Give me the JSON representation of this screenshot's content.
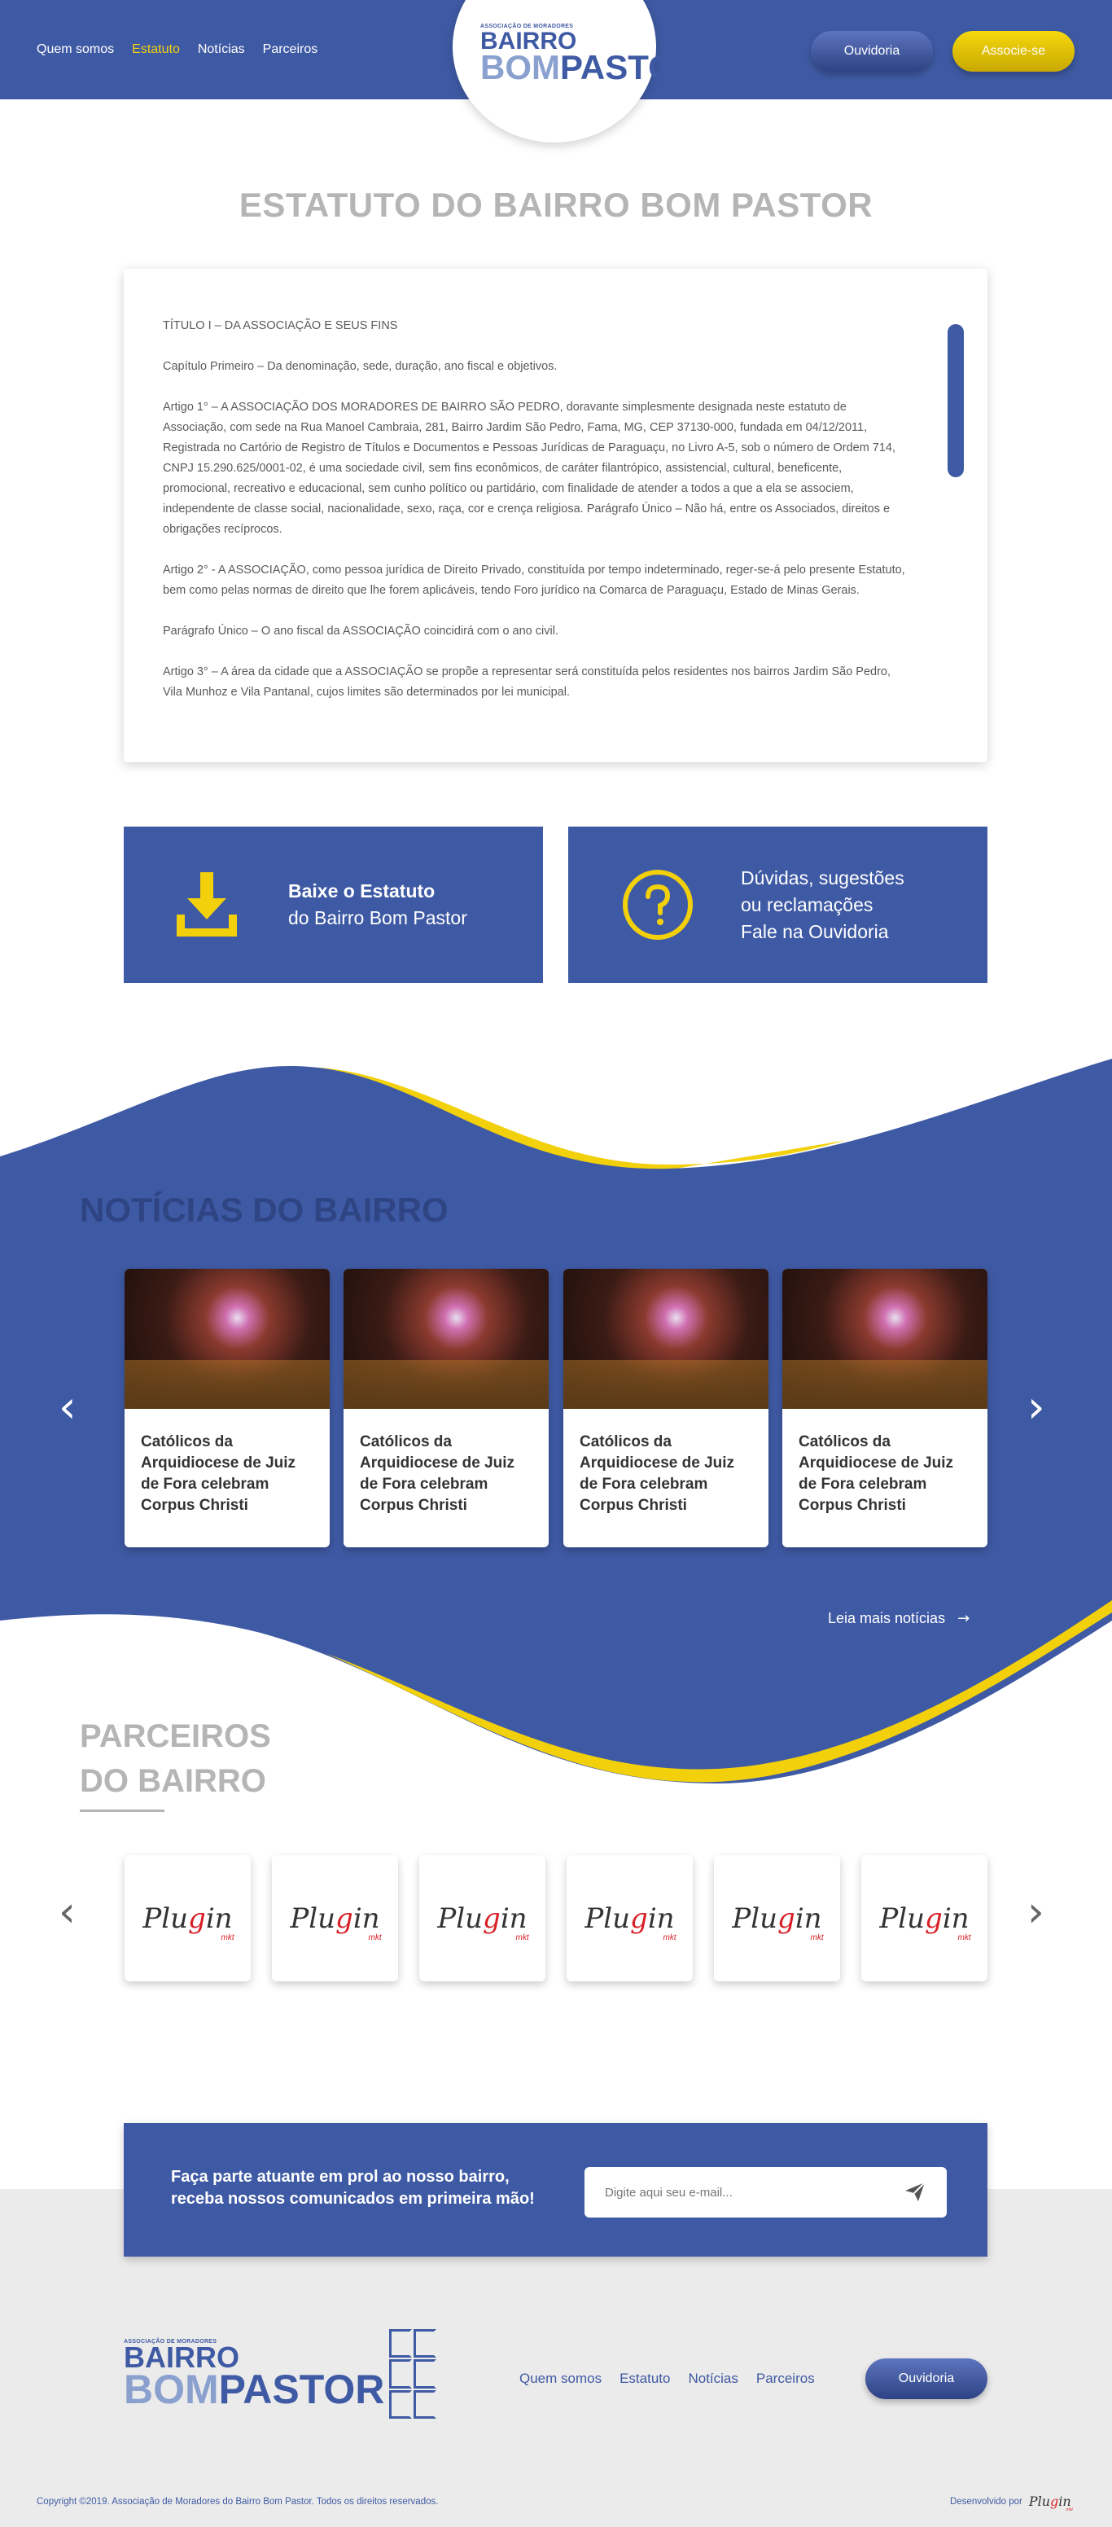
{
  "header": {
    "logo_small": "ASSOCIAÇÃO DE MORADORES",
    "logo_line1": "BAIRRO",
    "logo_line2a": "BOM",
    "logo_line2b": "PASTOR",
    "nav": [
      "Quem somos",
      "Estatuto",
      "Notícias",
      "Parceiros"
    ],
    "active_nav": "Estatuto",
    "ouvidoria_label": "Ouvidoria",
    "associe_label": "Associe-se"
  },
  "page_title": "ESTATUTO DO BAIRRO BOM PASTOR",
  "statute": {
    "paragraphs": [
      "TÍTULO I – DA ASSOCIAÇÃO E SEUS FINS",
      "Capítulo Primeiro – Da denominação, sede, duração, ano fiscal e objetivos.",
      "Artigo 1° – A ASSOCIAÇÃO DOS MORADORES DE BAIRRO SÃO PEDRO, doravante simplesmente designada neste estatuto de Associação, com sede na Rua Manoel Cambraia, 281, Bairro Jardim São Pedro, Fama, MG, CEP 37130-000, fundada em 04/12/2011, Registrada no Cartório de Registro de Títulos e Documentos e Pessoas Jurídicas de Paraguaçu,  no Livro A-5, sob o número de Ordem 714, CNPJ 15.290.625/0001-02, é uma sociedade civil, sem fins econômicos, de caráter filantrópico, assistencial, cultural, beneficente, promocional, recreativo e educacional, sem cunho político ou partidário, com finalidade de atender a todos a que a ela se associem, independente de classe social, nacionalidade, sexo, raça, cor e crença religiosa. Parágrafo Único – Não há, entre os Associados, direitos e obrigações recíprocos.",
      "Artigo 2° -  A ASSOCIAÇÃO, como pessoa jurídica de Direito Privado, constituída por tempo indeterminado, reger-se-á pelo presente Estatuto, bem como pelas normas de direito que lhe forem aplicáveis, tendo Foro jurídico na Comarca de Paraguaçu, Estado de Minas Gerais.",
      "Parágrafo Único – O ano fiscal da ASSOCIAÇÃO coincidirá com o ano civil.",
      "Artigo 3° – A área da cidade que a ASSOCIAÇÃO se propõe a representar será constituída pelos residentes nos bairros Jardim São Pedro, Vila Munhoz e Vila Pantanal, cujos limites são determinados por lei municipal."
    ]
  },
  "cta": {
    "download_bold": "Baixe o Estatuto",
    "download_light": "do Bairro Bom Pastor",
    "ouvidoria_line1": "Dúvidas, sugestões",
    "ouvidoria_line2": "ou reclamações",
    "ouvidoria_line3": "Fale na Ouvidoria"
  },
  "news": {
    "title": "NOTÍCIAS DO BAIRRO",
    "items": [
      {
        "title": "Católicos da Arquidiocese de Juiz de Fora celebram Corpus Christi"
      },
      {
        "title": "Católicos da Arquidiocese de Juiz de Fora celebram Corpus Christi"
      },
      {
        "title": "Católicos da Arquidiocese de Juiz de Fora celebram Corpus Christi"
      },
      {
        "title": "Católicos da Arquidiocese de Juiz de Fora celebram Corpus Christi"
      }
    ],
    "more_label": "Leia mais notícias"
  },
  "partners": {
    "title_line1": "PARCEIROS",
    "title_line2": "DO BAIRRO",
    "logo_text_a": "Plu",
    "logo_text_g": "g",
    "logo_text_b": "in",
    "logo_sub": "mkt"
  },
  "newsletter": {
    "line1": "Faça parte atuante em prol ao nosso bairro,",
    "line2": "receba nossos comunicados em primeira mão!",
    "placeholder": "Digite aqui seu e-mail..."
  },
  "footer": {
    "nav": [
      "Quem somos",
      "Estatuto",
      "Notícias",
      "Parceiros"
    ],
    "ouvidoria_label": "Ouvidoria",
    "copyright": "Copyright ©2019. Associação de Moradores do Bairro Bom Pastor. Todos os direitos reservados.",
    "dev_label": "Desenvolvido por"
  },
  "colors": {
    "primary": "#3f5aa4",
    "accent": "#f2d00b",
    "title_gray": "#b5b5b5",
    "footer_bg": "#ebebeb"
  }
}
